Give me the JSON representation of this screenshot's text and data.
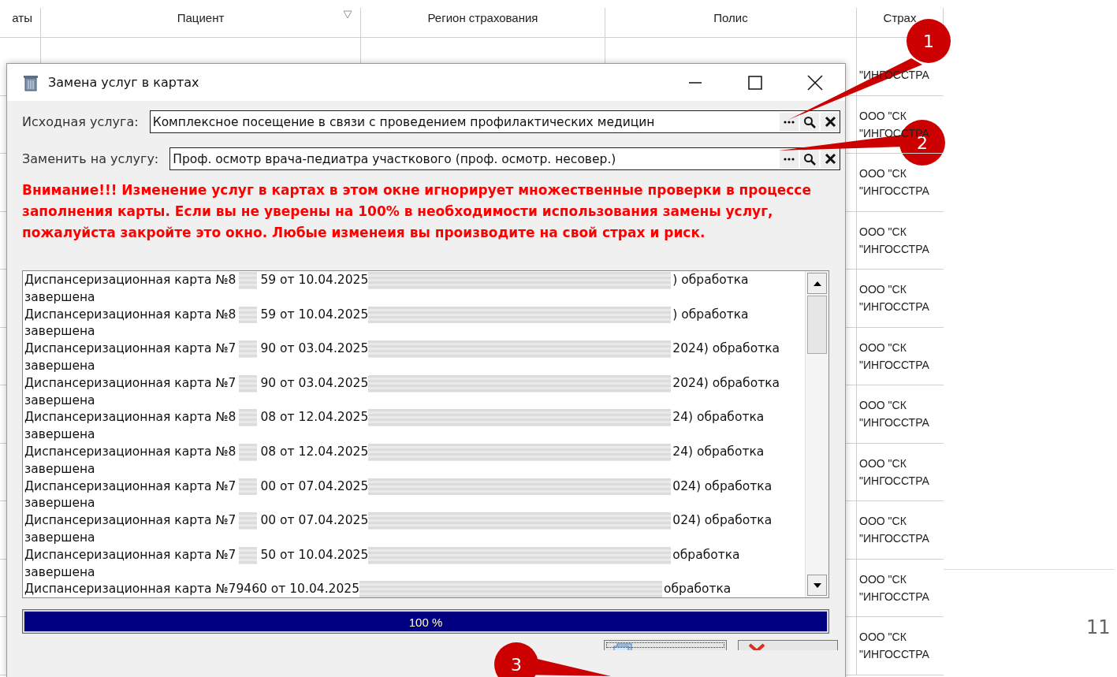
{
  "background_table": {
    "columns": [
      "аты",
      "Пациент",
      "Регион страхования",
      "Полис",
      "Страх"
    ],
    "column_5_cells": [
      [
        "\"ИНГОССТРА"
      ],
      [
        "ООО \"СК",
        "\"ИНГОССТРА"
      ],
      [
        "ООО \"СК",
        "\"ИНГОССТРА"
      ],
      [
        "ООО \"СК",
        "\"ИНГОССТРА"
      ],
      [
        "ООО \"СК",
        "\"ИНГОССТРА"
      ],
      [
        "ООО \"СК",
        "\"ИНГОССТРА"
      ],
      [
        "ООО \"СК",
        "\"ИНГОССТРА"
      ],
      [
        "ООО \"СК",
        "\"ИНГОССТРА"
      ],
      [
        "ООО \"СК",
        "\"ИНГОССТРА"
      ],
      [
        "ООО \"СК",
        "\"ИНГОССТРА"
      ],
      [
        "ООО \"СК",
        "\"ИНГОССТРА"
      ]
    ]
  },
  "dialog": {
    "title": "Замена услуг в картах",
    "fields": [
      {
        "label": "Исходная услуга:",
        "value": "Комплексное посещение  в связи с проведением профилактических медицин"
      },
      {
        "label": "Заменить на услугу:",
        "value": "Проф. осмотр врача-педиатра участкового (проф. осмотр. несовер.)"
      }
    ],
    "warning": "Внимание!!! Изменение услуг в картах в этом окне игнорирует множественные проверки в процессе заполнения карты. Если вы не уверены на 100% в необходимости использования замены услуг, пожалуйста закройте это окно. Любые изменеия вы производите на свой страх и риск.",
    "log": [
      {
        "parts": [
          "Диспансеризационная карта №8",
          "59 от 10.04.2025",
          ") обработка"
        ],
        "status": "завершена"
      },
      {
        "parts": [
          "Диспансеризационная карта №8",
          "59 от 10.04.2025",
          ") обработка"
        ],
        "status": "завершена"
      },
      {
        "parts": [
          "Диспансеризационная карта №7",
          "90 от 03.04.2025",
          "2024) обработка"
        ],
        "status": "завершена"
      },
      {
        "parts": [
          "Диспансеризационная карта №7",
          "90 от 03.04.2025",
          "2024) обработка"
        ],
        "status": "завершена"
      },
      {
        "parts": [
          "Диспансеризационная карта №8",
          "08 от 12.04.2025",
          "24) обработка"
        ],
        "status": "завершена"
      },
      {
        "parts": [
          "Диспансеризационная карта №8",
          "08 от 12.04.2025",
          "24) обработка"
        ],
        "status": "завершена"
      },
      {
        "parts": [
          "Диспансеризационная карта №7",
          "00 от 07.04.2025",
          "024) обработка"
        ],
        "status": "завершена"
      },
      {
        "parts": [
          "Диспансеризационная карта №7",
          "00 от 07.04.2025",
          "024) обработка"
        ],
        "status": "завершена"
      },
      {
        "parts": [
          "Диспансеризационная карта №7",
          "50 от 10.04.2025",
          " обработка"
        ],
        "status": "завершена"
      },
      {
        "parts": [
          "Диспансеризационная карта №79460 от 10.04.2025",
          "обработка"
        ]
      }
    ],
    "progress": {
      "level": 1,
      "label": "100 %"
    }
  },
  "callouts": [
    "1",
    "2",
    "3"
  ],
  "page_number": "11"
}
